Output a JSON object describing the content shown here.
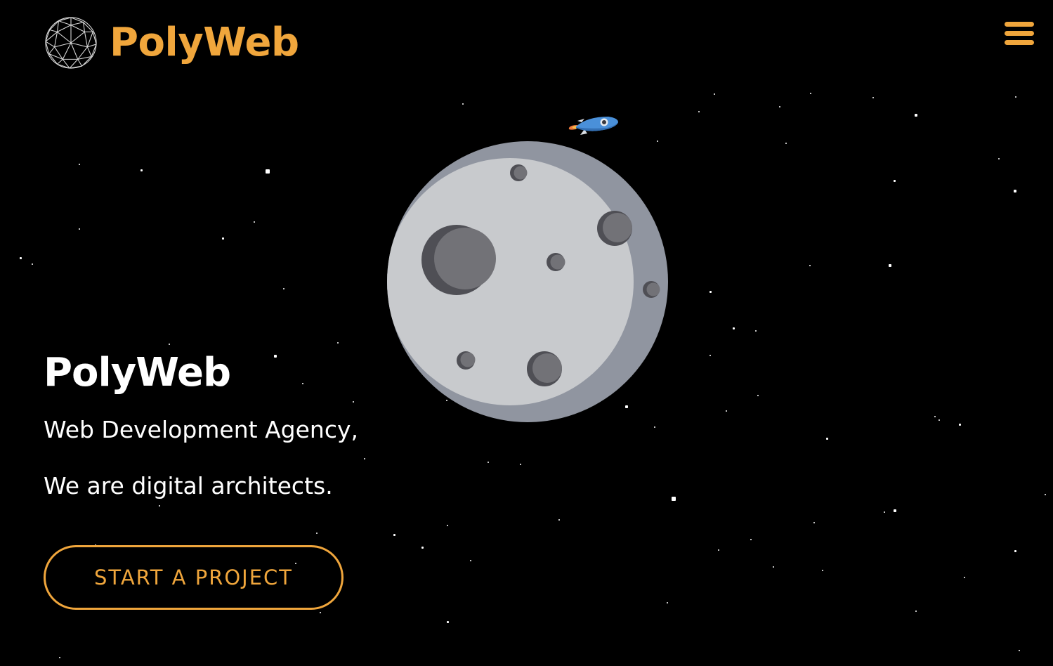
{
  "header": {
    "logo_text": "PolyWeb",
    "logo_icon": "geodesic-sphere-icon",
    "menu_icon": "hamburger-menu-icon"
  },
  "hero": {
    "title": "PolyWeb",
    "line1": "Web Development Agency,",
    "line2": "We are digital architects.",
    "cta_label": "START A PROJECT"
  },
  "illustration": {
    "moon": "moon-illustration",
    "rocket": "rocket-icon"
  },
  "colors": {
    "background": "#000000",
    "accent": "#f0a63c",
    "text": "#ffffff",
    "moon_light": "#c8cacd",
    "moon_shadow": "#9095a0",
    "crater": "#707075",
    "crater_dark": "#4a4a4f",
    "rocket_body": "#4a90d9"
  }
}
